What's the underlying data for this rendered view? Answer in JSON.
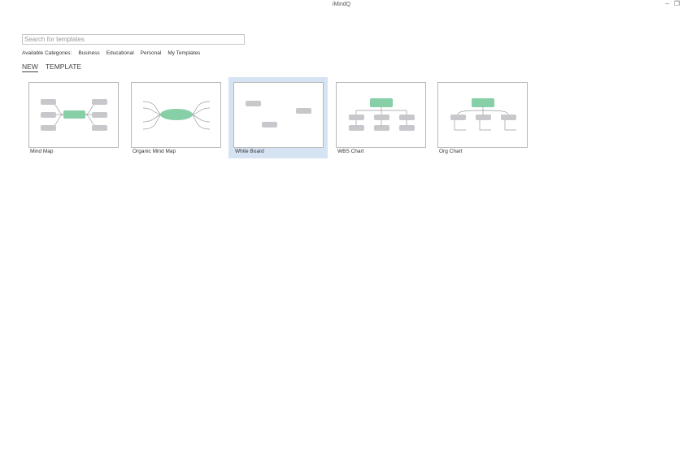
{
  "window": {
    "title": "iMindQ",
    "minimize_glyph": "–",
    "restore_glyph": "❐"
  },
  "search": {
    "placeholder": "Search for templates",
    "value": ""
  },
  "categories": {
    "label": "Available Categories:",
    "items": [
      "Business",
      "Educational",
      "Personal",
      "My Templates"
    ]
  },
  "tabs": [
    {
      "label": "NEW",
      "active": true
    },
    {
      "label": "TEMPLATE",
      "active": false
    }
  ],
  "templates": [
    {
      "label": "Mind Map",
      "selected": false
    },
    {
      "label": "Organic Mind Map",
      "selected": false
    },
    {
      "label": "White Board",
      "selected": true
    },
    {
      "label": "WBS Chart",
      "selected": false
    },
    {
      "label": "Org Chart",
      "selected": false
    }
  ],
  "colors": {
    "accent_green": "#86cfa7",
    "node_gray": "#c8c8cc",
    "selection_blue": "#d6e3f3",
    "line_gray": "#9a9a9a"
  }
}
